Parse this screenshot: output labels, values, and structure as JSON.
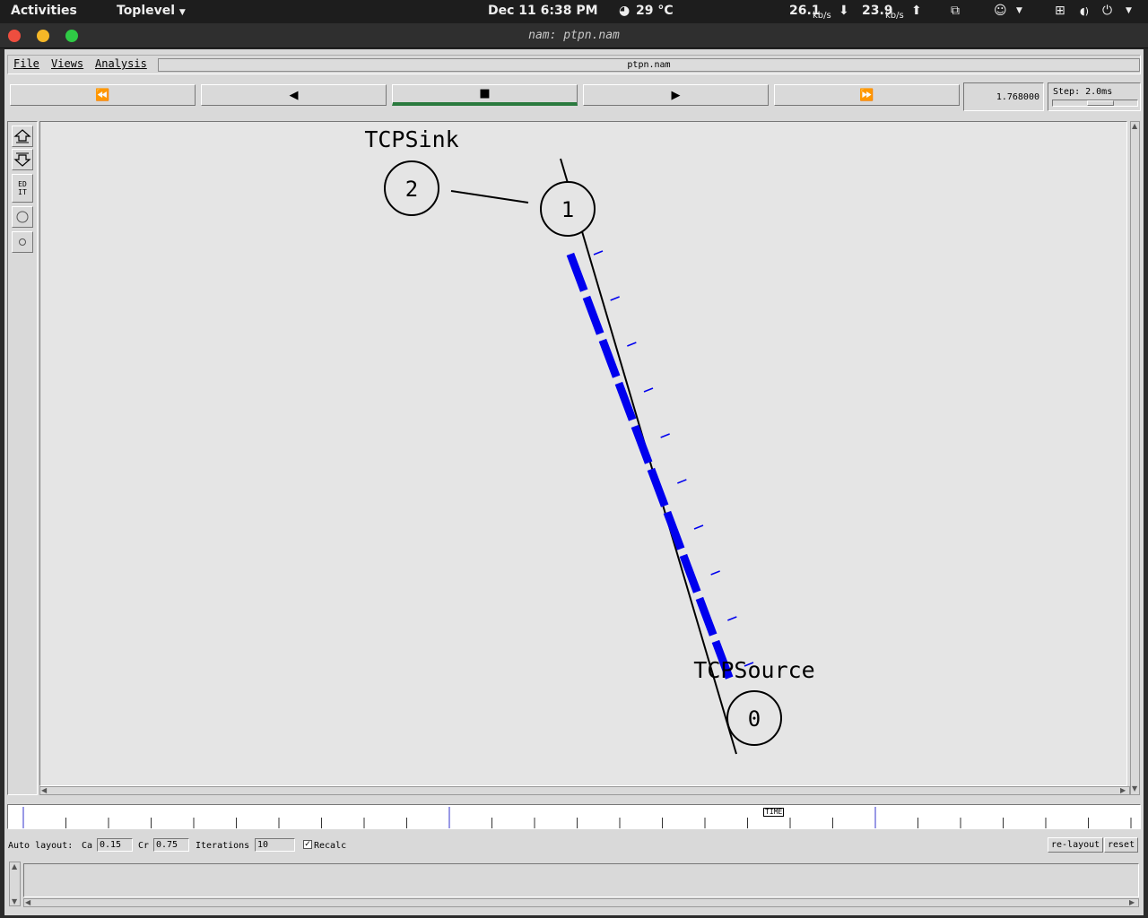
{
  "topbar": {
    "activities": "Activities",
    "app_menu": "Toplevel",
    "datetime": "Dec 11   6:38 PM",
    "weather": "29 °C",
    "net_down_value": "26.1",
    "net_down_unit": "kb/s",
    "net_up_value": "23.9",
    "net_up_unit": "kb/s"
  },
  "window": {
    "title": "nam: ptpn.nam"
  },
  "menubar": {
    "file": "File",
    "views": "Views",
    "analysis": "Analysis",
    "filename": "ptpn.nam"
  },
  "controls": {
    "rewind_icon": "⏪",
    "back_icon": "◀",
    "stop_icon": "■",
    "play_icon": "▶",
    "fastforward_icon": "⏩",
    "time_value": "1.768000",
    "step_label": "Step: 2.0ms",
    "step_slider_position": 0.45
  },
  "toolstrip": {
    "edit_label": "ED\nIT"
  },
  "network": {
    "nodes": [
      {
        "id": "2",
        "label": "TCPSink"
      },
      {
        "id": "1",
        "label": ""
      },
      {
        "id": "0",
        "label": "TCPSource"
      }
    ],
    "links": [
      {
        "from": "2",
        "to": "1"
      },
      {
        "from": "1",
        "to": "0"
      }
    ],
    "packet_color": "#0000ee",
    "packet_count": 10,
    "ack_count": 10
  },
  "timeline": {
    "marker_label": "TIME"
  },
  "layout": {
    "auto_layout_label": "Auto layout:",
    "ca_label": "Ca",
    "ca_value": "0.15",
    "cr_label": "Cr",
    "cr_value": "0.75",
    "iterations_label": "Iterations",
    "iterations_value": "10",
    "recalc_label": "Recalc",
    "recalc_checked": true,
    "relayout_button": "re-layout",
    "reset_button": "reset"
  }
}
